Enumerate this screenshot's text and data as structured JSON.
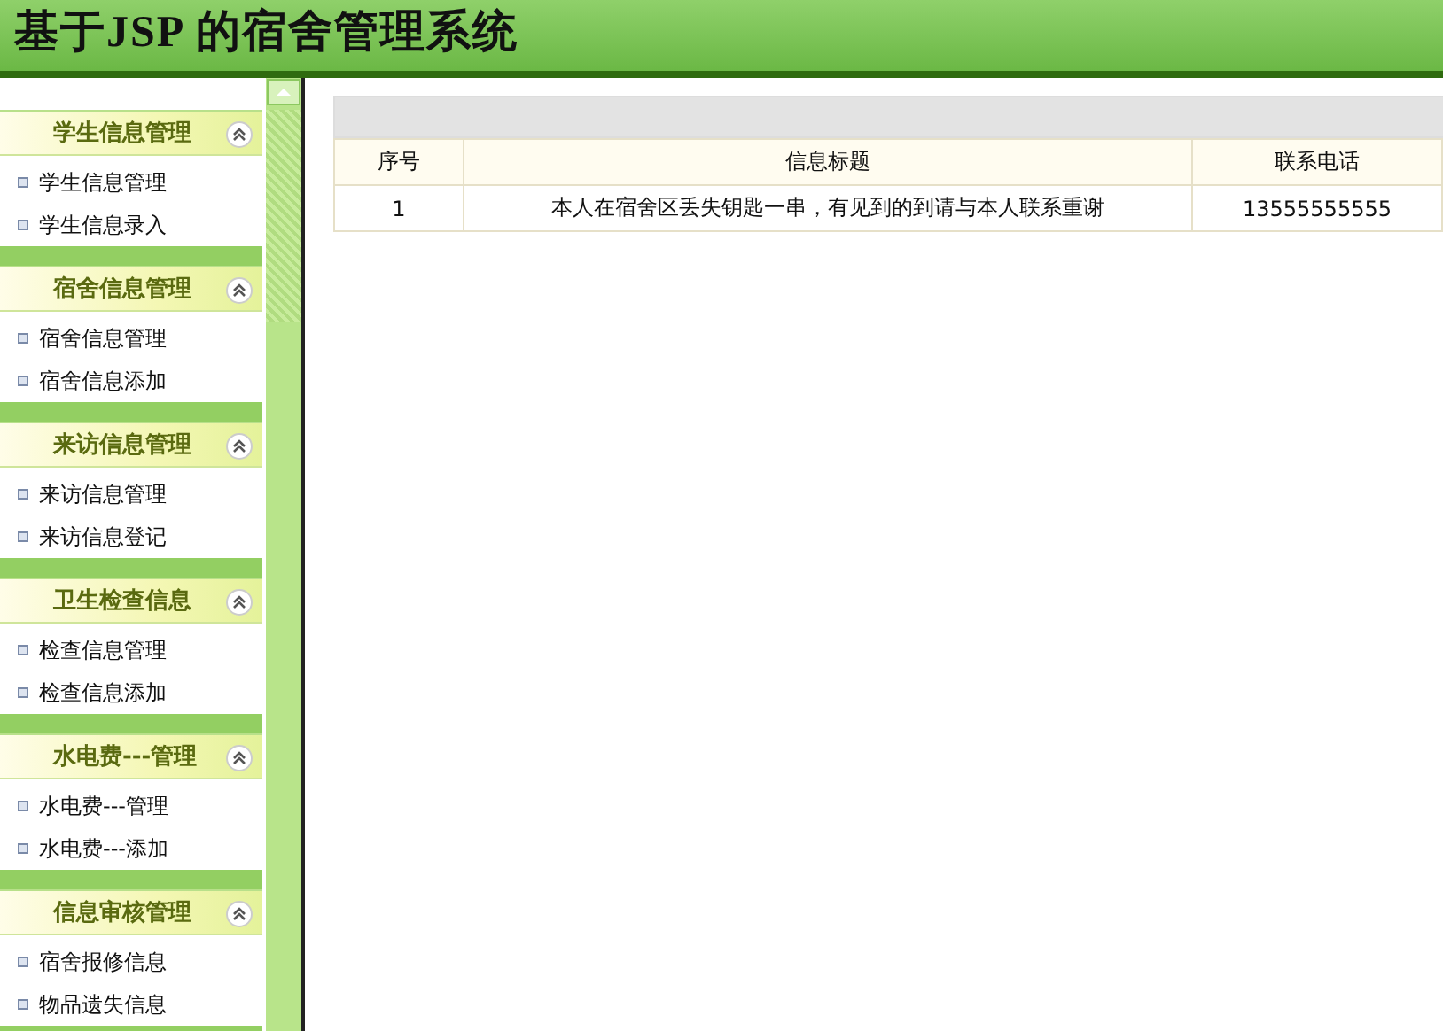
{
  "header": {
    "title": "基于JSP 的宿舍管理系统"
  },
  "sidebar": {
    "groups": [
      {
        "title": "学生信息管理",
        "expanded": true,
        "items": [
          "学生信息管理",
          "学生信息录入"
        ]
      },
      {
        "title": "宿舍信息管理",
        "expanded": true,
        "items": [
          "宿舍信息管理",
          "宿舍信息添加"
        ]
      },
      {
        "title": "来访信息管理",
        "expanded": true,
        "items": [
          "来访信息管理",
          "来访信息登记"
        ]
      },
      {
        "title": "卫生检查信息",
        "expanded": true,
        "items": [
          "检查信息管理",
          "检查信息添加"
        ]
      },
      {
        "title": "水电费---管理",
        "expanded": true,
        "items": [
          "水电费---管理",
          "水电费---添加"
        ]
      },
      {
        "title": "信息审核管理",
        "expanded": true,
        "items": [
          "宿舍报修信息",
          "物品遗失信息"
        ]
      }
    ]
  },
  "table": {
    "columns": [
      "序号",
      "信息标题",
      "联系电话"
    ],
    "rows": [
      [
        "1",
        "本人在宿舍区丢失钥匙一串，有见到的到请与本人联系重谢",
        "13555555555"
      ]
    ]
  }
}
